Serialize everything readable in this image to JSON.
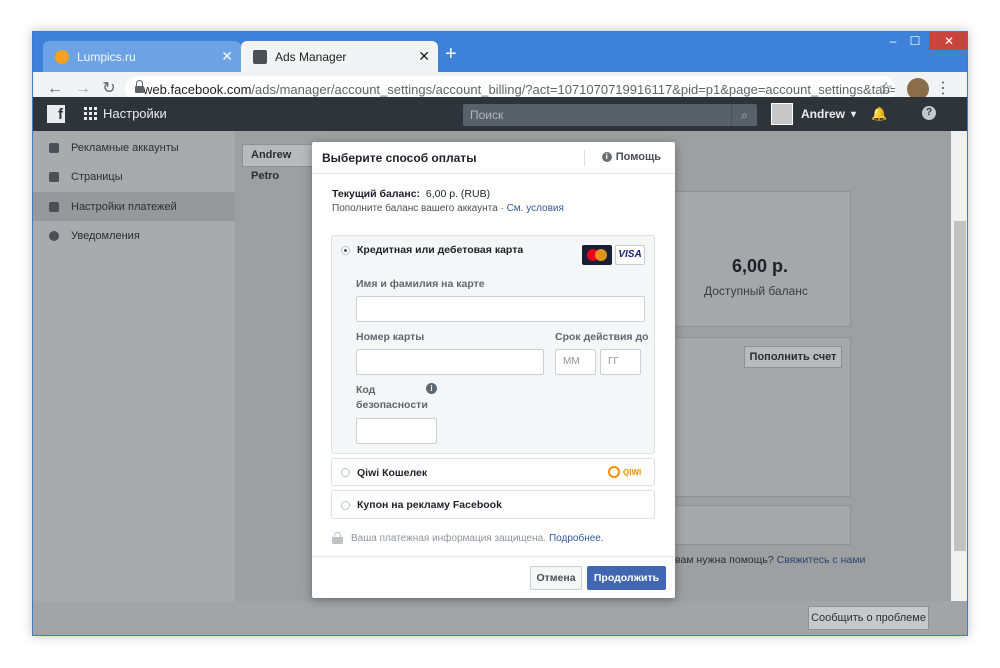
{
  "browser": {
    "tabs": [
      {
        "label": "Lumpics.ru",
        "close": "✕"
      },
      {
        "label": "Ads Manager",
        "close": "✕"
      }
    ],
    "new_tab": "+",
    "controls": {
      "minimize": "–",
      "maximize": "☐",
      "close": "✕"
    },
    "nav": {
      "back": "←",
      "forward": "→",
      "reload": "↻",
      "star": "☆",
      "menu": "⋮"
    },
    "url_host": "web.facebook.com",
    "url_path": "/ads/manager/account_settings/account_billing/?act=1071070719916117&pid=p1&page=account_settings&tab=accou..."
  },
  "fb_header": {
    "title": "Настройки",
    "search_placeholder": "Поиск",
    "user_name": "Andrew",
    "user_caret": "▾",
    "bell": "🔔",
    "help": "?"
  },
  "sidebar": {
    "items": [
      {
        "label": "Рекламные аккаунты"
      },
      {
        "label": "Страницы"
      },
      {
        "label": "Настройки платежей"
      },
      {
        "label": "Уведомления"
      }
    ]
  },
  "background": {
    "account_button": "Andrew Petro",
    "balance_value": "6,00 р.",
    "balance_label": "Доступный баланс",
    "topup_button": "Пополнить счет",
    "need_help": "вам нужна помощь?",
    "contact_link": "Свяжитесь с нами",
    "report_button": "Сообщить о проблеме"
  },
  "modal": {
    "title": "Выберите способ оплаты",
    "help": "Помощь",
    "balance_label": "Текущий баланс:",
    "balance_value": "6,00 р. (RUB)",
    "topup_text": "Пополните баланс вашего аккаунта ·",
    "terms_link": "См. условия",
    "options": {
      "card": "Кредитная или дебетовая карта",
      "qiwi": "Qiwi Кошелек",
      "coupon": "Купон на рекламу Facebook"
    },
    "card_brands": {
      "visa": "VISA",
      "qiwi": "QIWI"
    },
    "fields": {
      "name_label": "Имя и фамилия на карте",
      "number_label": "Номер карты",
      "expiry_label": "Срок действия до",
      "month_placeholder": "ММ",
      "year_placeholder": "ГГ",
      "cvv_label_1": "Код",
      "cvv_label_2": "безопасности",
      "info": "i"
    },
    "secure_text": "Ваша платежная информация защищена.",
    "secure_link": "Подробнее.",
    "cancel": "Отмена",
    "continue": "Продолжить"
  },
  "colors": {
    "primary_button": "#4267b2",
    "link": "#365899",
    "fb_header": "#2f343b",
    "chrome_tabstrip": "#3d82d8"
  }
}
